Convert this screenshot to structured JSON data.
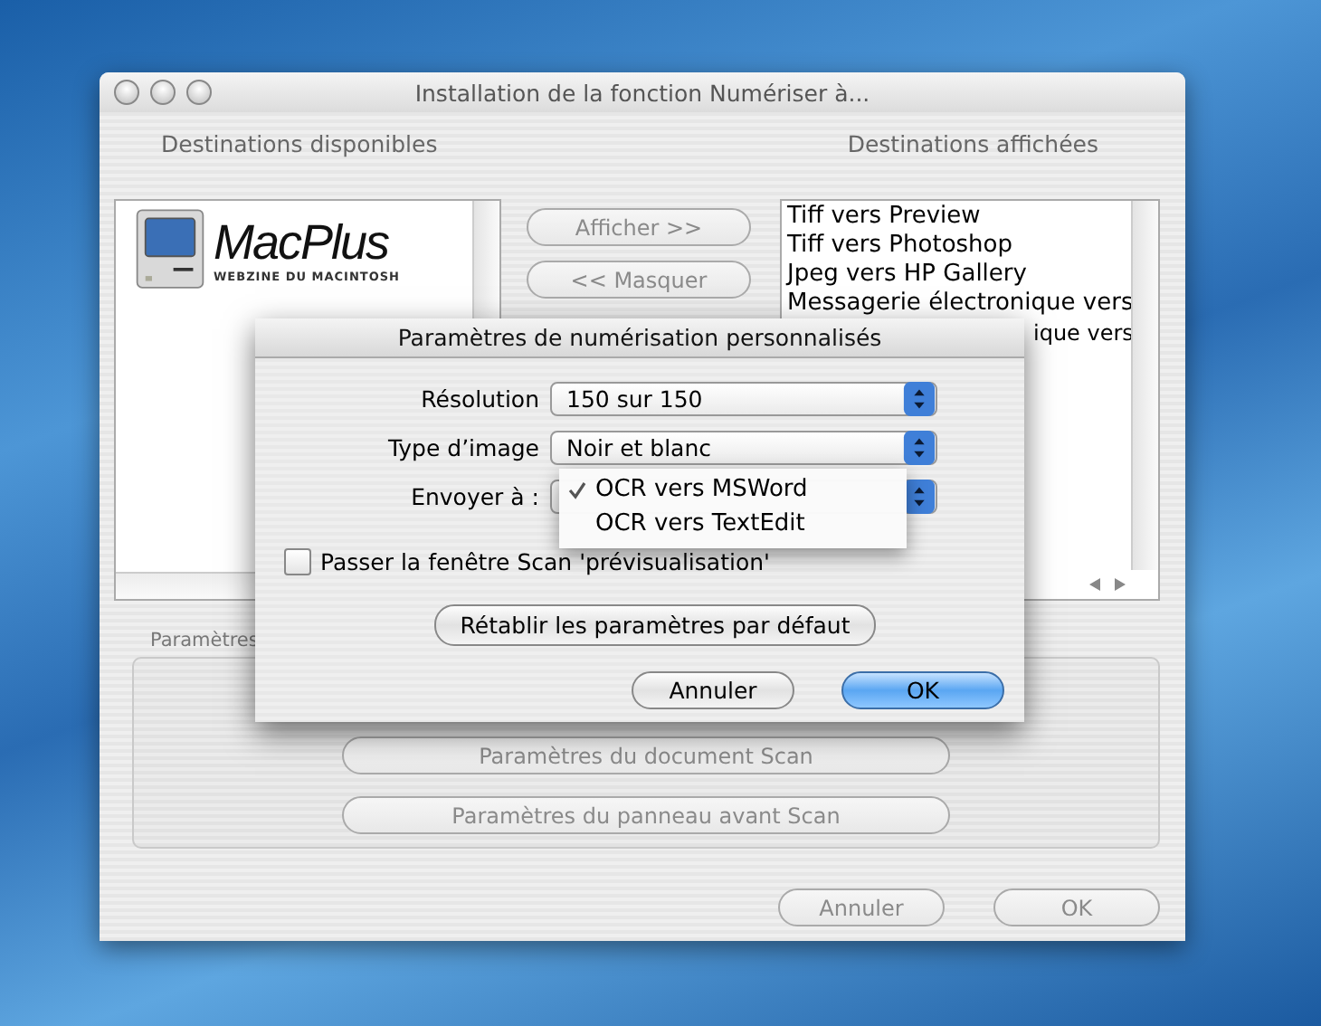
{
  "window": {
    "title": "Installation de la fonction Numériser à..."
  },
  "available": {
    "heading": "Destinations disponibles",
    "logo": {
      "name": "MacPlus",
      "tagline": "WEBZINE DU MACINTOSH"
    }
  },
  "move_buttons": [
    {
      "label": "Afficher >>",
      "disabled": true
    },
    {
      "label": "<< Masquer",
      "disabled": true
    }
  ],
  "shown": {
    "heading": "Destinations affichées",
    "items": [
      {
        "label": "Tiff vers Preview",
        "kind": "full"
      },
      {
        "label": "Tiff vers Photoshop",
        "kind": "full"
      },
      {
        "label": "Jpeg vers HP Gallery",
        "kind": "full"
      },
      {
        "label": "Messagerie électronique vers",
        "kind": "full"
      },
      {
        "label": "ique vers",
        "kind": "tail"
      }
    ]
  },
  "settings_group": {
    "label": "Paramètres",
    "buttons": [
      {
        "label": "Paramètres du document Scan",
        "disabled": true
      },
      {
        "label": "Paramètres du panneau avant Scan",
        "disabled": true
      }
    ]
  },
  "buttons": [
    {
      "label": "Annuler",
      "disabled": true
    },
    {
      "label": "OK",
      "disabled": true
    }
  ],
  "sheet": {
    "title": "Paramètres de numérisation personnalisés",
    "fields": [
      {
        "label": "Résolution",
        "value": "150 sur 150"
      },
      {
        "label": "Type d’image",
        "value": "Noir et blanc"
      },
      {
        "label": "Envoyer à :",
        "menu": [
          {
            "label": "OCR vers MSWord",
            "checked": true
          },
          {
            "label": "OCR vers TextEdit",
            "checked": false
          }
        ]
      }
    ],
    "checkbox": {
      "label": "Passer la fenêtre Scan 'prévisualisation'",
      "checked": false
    },
    "reset_button": "Rétablir les paramètres par défaut",
    "buttons": [
      {
        "label": "Annuler",
        "default": false
      },
      {
        "label": "OK",
        "default": true
      }
    ]
  }
}
